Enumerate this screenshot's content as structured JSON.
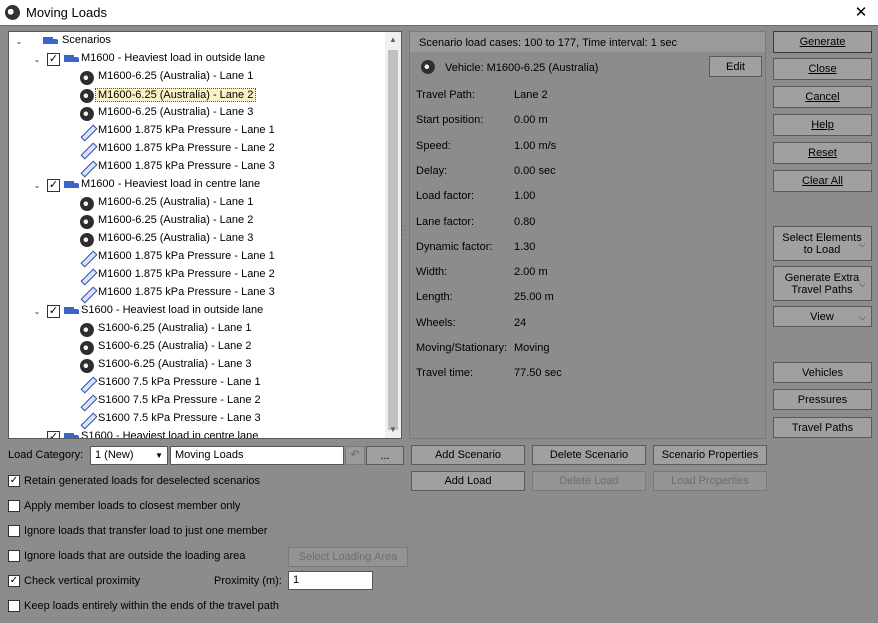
{
  "window": {
    "title": "Moving Loads",
    "close_glyph": "✕"
  },
  "tree": {
    "root": "Scenarios",
    "groups": [
      {
        "label": "M1600 - Heaviest load in outside lane",
        "items": [
          "M1600-6.25 (Australia) - Lane 1",
          "M1600-6.25 (Australia) - Lane 2",
          "M1600-6.25 (Australia) - Lane 3",
          "M1600 1.875 kPa Pressure - Lane 1",
          "M1600 1.875 kPa Pressure - Lane 2",
          "M1600 1.875 kPa Pressure - Lane 3"
        ]
      },
      {
        "label": "M1600 - Heaviest load in centre lane",
        "items": [
          "M1600-6.25 (Australia) - Lane 1",
          "M1600-6.25 (Australia) - Lane 2",
          "M1600-6.25 (Australia) - Lane 3",
          "M1600 1.875 kPa Pressure - Lane 1",
          "M1600 1.875 kPa Pressure - Lane 2",
          "M1600 1.875 kPa Pressure - Lane 3"
        ]
      },
      {
        "label": "S1600 - Heaviest load in outside lane",
        "items": [
          "S1600-6.25 (Australia) - Lane 1",
          "S1600-6.25 (Australia) - Lane 2",
          "S1600-6.25 (Australia) - Lane 3",
          "S1600 7.5 kPa Pressure - Lane 1",
          "S1600 7.5 kPa Pressure - Lane 2",
          "S1600 7.5 kPa Pressure - Lane 3"
        ]
      },
      {
        "label": "S1600 - Heaviest load in centre lane",
        "items": []
      }
    ],
    "selected_item": "M1600-6.25 (Australia) - Lane 2"
  },
  "scenario": {
    "header": "Scenario load cases: 100 to 177, Time interval: 1 sec",
    "vehicle": "Vehicle: M1600-6.25 (Australia)",
    "edit_label": "Edit",
    "properties": [
      {
        "label": "Travel Path:",
        "value": "Lane 2"
      },
      {
        "label": "Start position:",
        "value": "0.00 m"
      },
      {
        "label": "Speed:",
        "value": "1.00 m/s"
      },
      {
        "label": "Delay:",
        "value": "0.00 sec"
      },
      {
        "label": "Load factor:",
        "value": "1.00"
      },
      {
        "label": "Lane factor:",
        "value": "0.80"
      },
      {
        "label": "Dynamic factor:",
        "value": "1.30"
      },
      {
        "label": "Width:",
        "value": "2.00 m"
      },
      {
        "label": "Length:",
        "value": "25.00 m"
      },
      {
        "label": "Wheels:",
        "value": "24"
      },
      {
        "label": "Moving/Stationary:",
        "value": "Moving"
      },
      {
        "label": "Travel time:",
        "value": "77.50 sec"
      }
    ]
  },
  "right_buttons": {
    "generate": "Generate",
    "close": "Close",
    "cancel": "Cancel",
    "help": "Help",
    "reset": "Reset",
    "clear_all": "Clear All",
    "select_elements": "Select Elements to Load",
    "generate_extra": "Generate Extra Travel Paths",
    "view": "View",
    "vehicles": "Vehicles",
    "pressures": "Pressures",
    "travel_paths": "Travel Paths"
  },
  "bottom": {
    "load_category_label": "Load Category:",
    "load_category_value": "1 (New)",
    "load_category_name": "Moving Loads",
    "ellipsis": "...",
    "undo_glyph": "↶",
    "add_scenario": "Add Scenario",
    "delete_scenario": "Delete Scenario",
    "scenario_properties": "Scenario Properties",
    "add_load": "Add Load",
    "delete_load": "Delete Load",
    "load_properties": "Load Properties",
    "select_loading_area": "Select Loading Area",
    "proximity_label": "Proximity (m):",
    "proximity_value": "1",
    "checks": [
      {
        "label": "Retain generated loads for deselected scenarios",
        "checked": true
      },
      {
        "label": "Apply member loads to closest member only",
        "checked": false
      },
      {
        "label": "Ignore loads that transfer load to just one member",
        "checked": false
      },
      {
        "label": "Ignore loads that are outside the loading area",
        "checked": false
      },
      {
        "label": "Check vertical proximity",
        "checked": true
      },
      {
        "label": "Keep loads entirely within the ends of the travel path",
        "checked": false
      }
    ]
  }
}
